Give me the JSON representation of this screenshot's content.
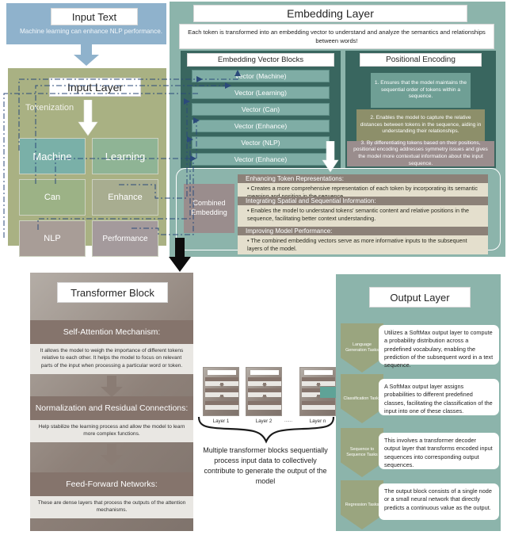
{
  "input_text": {
    "title": "Input Text",
    "body": "Machine learning can enhance NLP performance.",
    "color": "#8fb2cc"
  },
  "input_layer": {
    "title": "Input Layer",
    "tokenization_label": "Tokenization",
    "color": "#a9b183",
    "tokens": [
      {
        "label": "Machine",
        "color": "#7ab0a8",
        "font": 13
      },
      {
        "label": "Learning",
        "color": "#8fb495",
        "font": 13
      },
      {
        "label": "Can",
        "color": "#9cb286",
        "font": 11
      },
      {
        "label": "Enhance",
        "color": "#a8ad90",
        "font": 11
      },
      {
        "label": "NLP",
        "color": "#a89d97",
        "font": 11
      },
      {
        "label": "Performance",
        "color": "#a49a9c",
        "font": 10
      }
    ]
  },
  "embedding_layer": {
    "title": "Embedding Layer",
    "caption": "Each token is transformed into an embedding vector to understand and analyze the semantics and relationships between words!",
    "color": "#8cb4ab",
    "vector_blocks": {
      "title": "Embedding Vector Blocks",
      "items": [
        "Vector (Machine)",
        "Vector (Learning)",
        "Vector (Can)",
        "Vector (Enhance)",
        "Vector (NLP)",
        "Vector (Enhance)"
      ]
    },
    "positional_encoding": {
      "title": "Positional Encoding",
      "items": [
        {
          "text": "1. Ensures that the model maintains the sequential order of tokens within a sequence.",
          "color": "#6f9f95"
        },
        {
          "text": "2. Enables the model to capture the relative distances between tokens in the sequence,  aiding in understanding their relationships.",
          "color": "#8d8f6a"
        },
        {
          "text": "3. By differentiating tokens based on their positions, positional encoding addresses symmetry issues and gives the model more contextual information about the input sequence.",
          "color": "#9a8d8d"
        }
      ]
    }
  },
  "combined_embedding": {
    "chip_label": "Combined Embedding",
    "sections": [
      {
        "heading": "Enhancing Token Representations:",
        "bullet": "• Creates a more comprehensive representation of each token by incorporating its semantic meaning and position in the sequence."
      },
      {
        "heading": "Integrating Spatial and Sequential Information:",
        "bullet": "• Enables the model to understand tokens' semantic content and relative positions in the sequence, facilitating better context understanding."
      },
      {
        "heading": "Improving Model Performance:",
        "bullet": "• The combined embedding vectors serve as more informative inputs to the subsequent layers of the model."
      }
    ]
  },
  "transformer_block": {
    "title": "Transformer Block",
    "sections": [
      {
        "heading": "Self-Attention Mechanism:",
        "body": "It allows the model to weigh the importance of different tokens relative to each other. It helps the model to focus on relevant parts of the input when processing a particular word or token."
      },
      {
        "heading": "Normalization and Residual Connections:",
        "body": "Help stabilize the learning process and allow the model to learn more complex functions."
      },
      {
        "heading": "Feed-Forward Networks:",
        "body": "These are dense layers that process the outputs of the attention mechanisms."
      }
    ]
  },
  "multi_layer": {
    "layers": [
      "Layer 1",
      "Layer 2",
      "Layer n"
    ],
    "ellipsis": "......",
    "caption": "Multiple transformer blocks sequentially process input data to collectively contribute to generate the output of the model"
  },
  "output_layer": {
    "title": "Output Layer",
    "color": "#8cb4ab",
    "tasks": [
      {
        "tag": "Language Generation Tasks",
        "text": "Utilizes a SoftMax output layer to compute a probability distribution across a predefined vocabulary, enabling the prediction of the subsequent word in a text sequence."
      },
      {
        "tag": "Classification Tasks",
        "text": "A SoftMax output layer assigns probabilities to different predefined classes, facilitating the classification of the input into one of these classes."
      },
      {
        "tag": "Sequence to Sequence Tasks",
        "text": "This involves a transformer decoder output layer that transforms encoded input sequences into corresponding output sequences."
      },
      {
        "tag": "Regression Tasks",
        "text": "The output block consists of a single node or a small neural network that directly predicts a continuous value as the output."
      }
    ]
  }
}
